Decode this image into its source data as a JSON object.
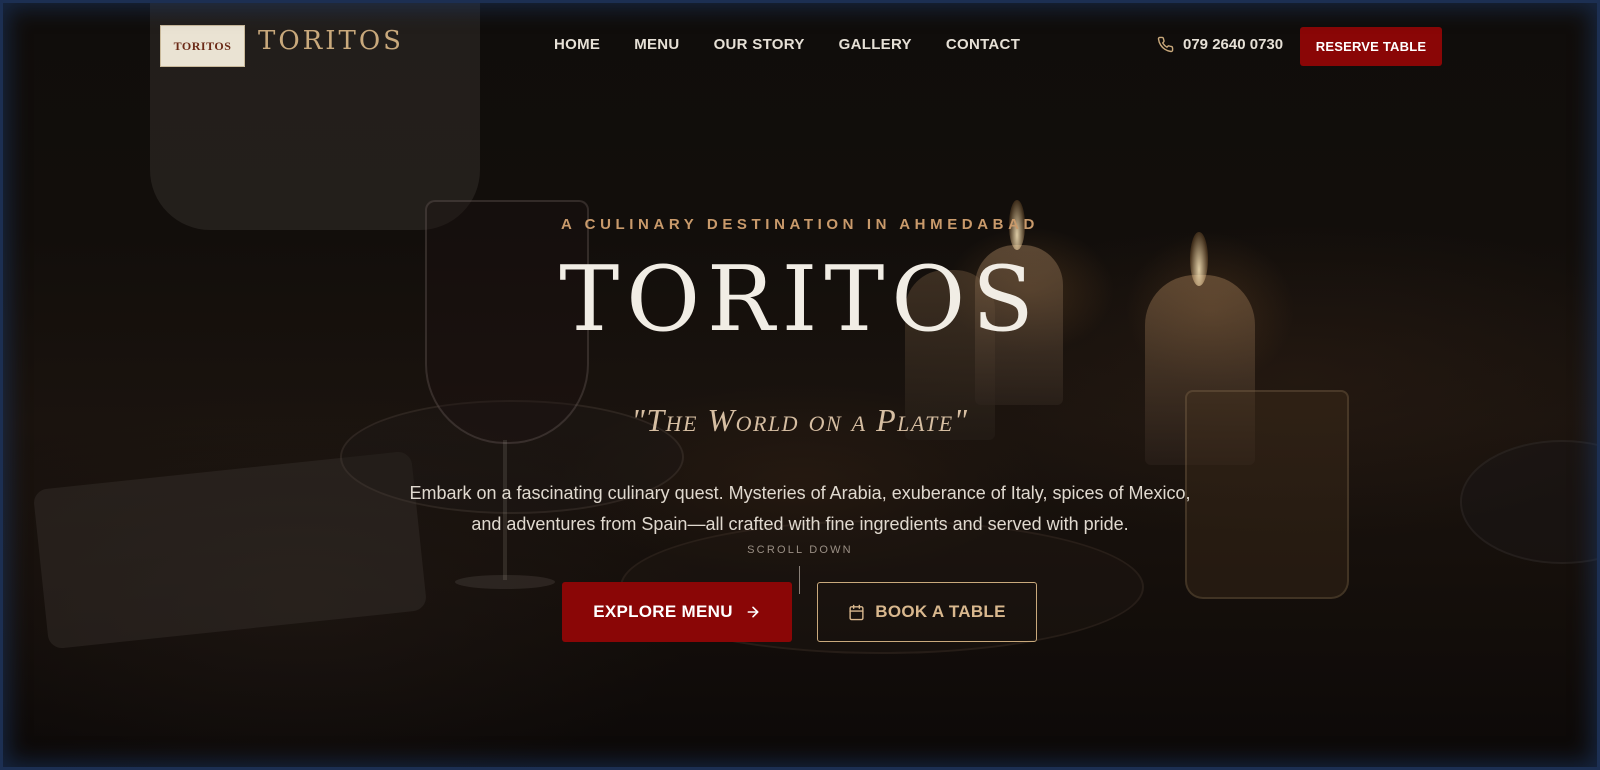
{
  "header": {
    "logo_text": "TORITOS",
    "brand": "TORITOS",
    "nav": [
      "HOME",
      "MENU",
      "OUR STORY",
      "GALLERY",
      "CONTACT"
    ],
    "phone": "079 2640 0730",
    "reserve_label": "RESERVE TABLE"
  },
  "hero": {
    "kicker": "A CULINARY DESTINATION IN AHMEDABAD",
    "title": "TORITOS",
    "tagline": "\"The World on a Plate\"",
    "description": "Embark on a fascinating culinary quest. Mysteries of Arabia, exuberance of Italy, spices of Mexico, and adventures from Spain—all crafted with fine ingredients and served with pride.",
    "scroll_label": "SCROLL DOWN",
    "explore_label": "EXPLORE MENU",
    "book_label": "BOOK A TABLE"
  },
  "colors": {
    "accent_red": "#8a0606",
    "gold": "#c9a97c",
    "kicker": "#c99a6b"
  },
  "icons": [
    "phone-icon",
    "arrow-right-icon",
    "calendar-icon"
  ]
}
